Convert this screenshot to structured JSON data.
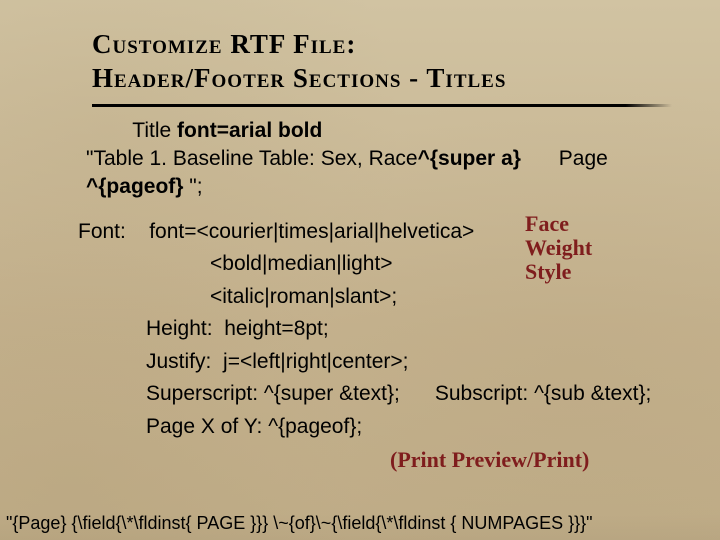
{
  "heading_line1": "Customize RTF File:",
  "heading_line2": "Header/Footer Sections - Titles",
  "title": {
    "label": "Title",
    "bold": "font=arial bold",
    "example_prefix": "\"Table 1. Baseline Table: Sex, Race",
    "super_token": "^{super a}",
    "page_label": "Page",
    "pageof_token": "^{pageof}",
    "example_suffix": " \";"
  },
  "annotations": {
    "face": "Face",
    "weight": "Weight",
    "style": "Style",
    "print_preview": "(Print Preview/Print)"
  },
  "defs": {
    "font_label": "Font:",
    "font_value": "font=<courier|times|arial|helvetica>",
    "bold_value": "<bold|median|light>",
    "italic_value": "<italic|roman|slant>;",
    "height_label": "Height:",
    "height_value": "height=8pt;",
    "justify_label": "Justify:",
    "justify_value": "j=<left|right|center>;",
    "super_label": "Superscript:",
    "super_value": "^{super &text};",
    "sub_label": "Subscript:",
    "sub_value": "^{sub &text};",
    "pagexy_label": "Page X of Y:",
    "pagexy_value": "^{pageof};"
  },
  "codeline": "\"{Page} {\\field{\\*\\fldinst{ PAGE }}} \\~{of}\\~{\\field{\\*\\fldinst { NUMPAGES }}}\""
}
